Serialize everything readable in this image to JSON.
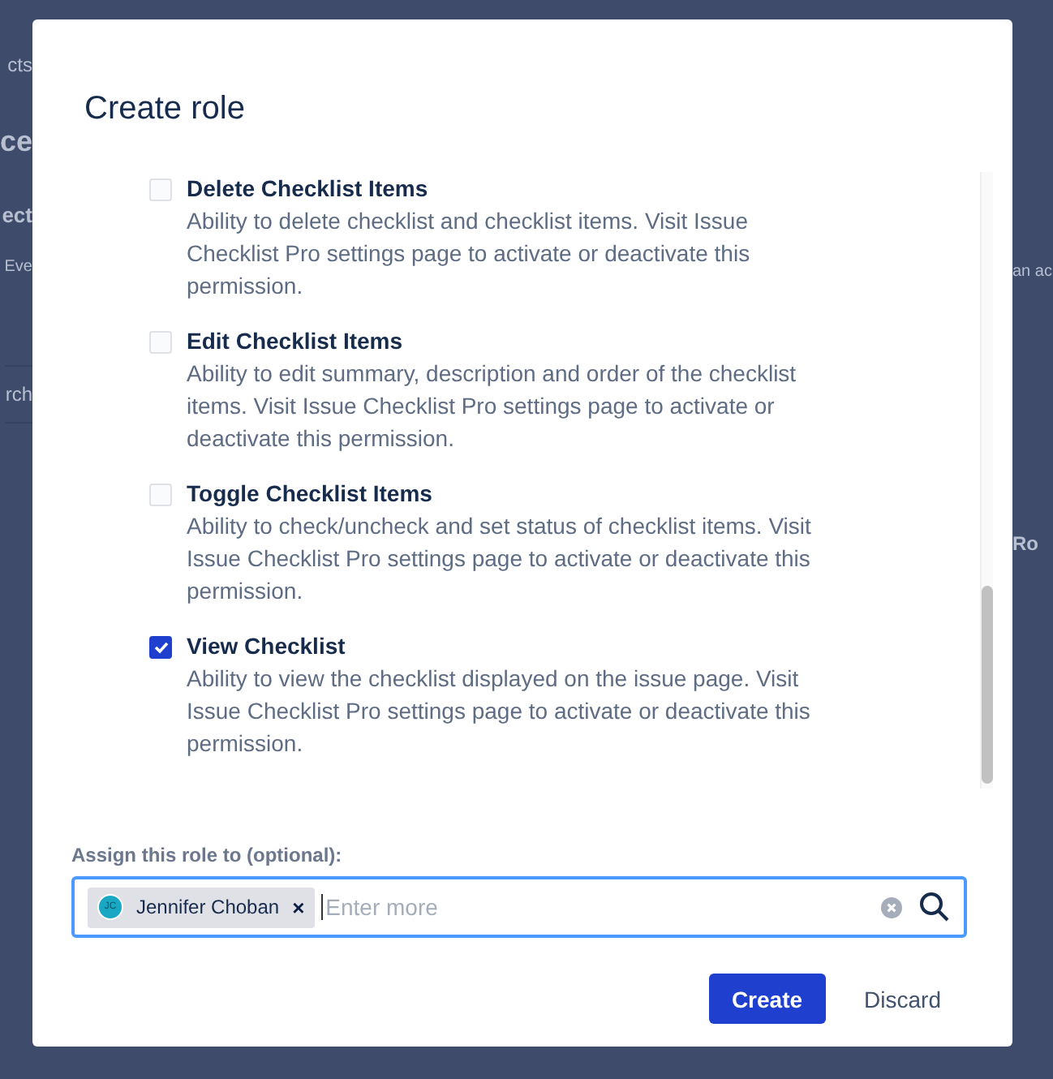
{
  "background": {
    "left_fragments": [
      {
        "kind": "crumb",
        "text": "cts"
      },
      {
        "kind": "heading",
        "text": "ce"
      },
      {
        "kind": "subheading",
        "text": "ect"
      },
      {
        "kind": "text",
        "text": "Eve"
      },
      {
        "kind": "search",
        "text": "rch"
      }
    ],
    "right_fragments": [
      {
        "kind": "text",
        "text": "an ac"
      },
      {
        "kind": "column",
        "text": "Ro"
      }
    ]
  },
  "dialog": {
    "title": "Create role",
    "permissions": [
      {
        "label": "Delete Checklist Items",
        "description": "Ability to delete checklist and checklist items. Visit Issue Checklist Pro settings page to activate or deactivate this permission.",
        "checked": false
      },
      {
        "label": "Edit Checklist Items",
        "description": "Ability to edit summary, description and order of the checklist items. Visit Issue Checklist Pro settings page to activate or deactivate this permission.",
        "checked": false
      },
      {
        "label": "Toggle Checklist Items",
        "description": "Ability to check/uncheck and set status of checklist items. Visit Issue Checklist Pro settings page to activate or deactivate this permission.",
        "checked": false
      },
      {
        "label": "View Checklist",
        "description": "Ability to view the checklist displayed on the issue page. Visit Issue Checklist Pro settings page to activate or deactivate this permission.",
        "checked": true
      }
    ],
    "assign": {
      "label": "Assign this role to (optional):",
      "chips": [
        {
          "initials": "JC",
          "name": "Jennifer Choban",
          "remove": "×"
        }
      ],
      "placeholder": "Enter more"
    },
    "buttons": [
      {
        "label": "Create",
        "kind": "primary"
      },
      {
        "label": "Discard",
        "kind": "subtle"
      }
    ]
  }
}
